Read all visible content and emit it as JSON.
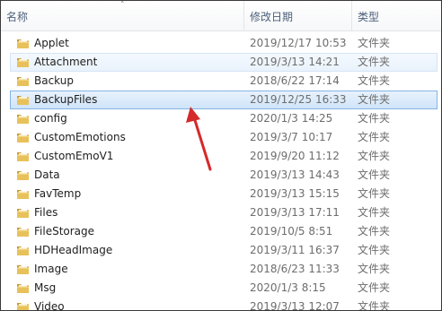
{
  "header": {
    "name_label": "名称",
    "date_label": "修改日期",
    "type_label": "类型",
    "sort_indicator": "˄"
  },
  "files": [
    {
      "name": "Applet",
      "date": "2019/12/17 10:53",
      "type": "文件夹",
      "state": "normal"
    },
    {
      "name": "Attachment",
      "date": "2019/3/13 14:21",
      "type": "文件夹",
      "state": "hover"
    },
    {
      "name": "Backup",
      "date": "2018/6/22 17:14",
      "type": "文件夹",
      "state": "normal"
    },
    {
      "name": "BackupFiles",
      "date": "2019/12/25 16:33",
      "type": "文件夹",
      "state": "selected"
    },
    {
      "name": "config",
      "date": "2020/1/3 14:25",
      "type": "文件夹",
      "state": "normal"
    },
    {
      "name": "CustomEmotions",
      "date": "2019/3/7 10:17",
      "type": "文件夹",
      "state": "normal"
    },
    {
      "name": "CustomEmoV1",
      "date": "2019/9/20 11:12",
      "type": "文件夹",
      "state": "normal"
    },
    {
      "name": "Data",
      "date": "2019/3/13 14:43",
      "type": "文件夹",
      "state": "normal"
    },
    {
      "name": "FavTemp",
      "date": "2019/3/13 15:15",
      "type": "文件夹",
      "state": "normal"
    },
    {
      "name": "Files",
      "date": "2019/3/13 17:11",
      "type": "文件夹",
      "state": "normal"
    },
    {
      "name": "FileStorage",
      "date": "2019/10/5 8:51",
      "type": "文件夹",
      "state": "normal"
    },
    {
      "name": "HDHeadImage",
      "date": "2019/3/11 16:37",
      "type": "文件夹",
      "state": "normal"
    },
    {
      "name": "Image",
      "date": "2018/6/23 11:33",
      "type": "文件夹",
      "state": "normal"
    },
    {
      "name": "Msg",
      "date": "2020/1/3 8:15",
      "type": "文件夹",
      "state": "normal"
    },
    {
      "name": "Video",
      "date": "2019/3/13 12:07",
      "type": "文件夹",
      "state": "normal"
    }
  ],
  "colors": {
    "folder_body": "#e8c15a",
    "folder_dark": "#c99a2e",
    "annotation_arrow": "#d42a2a",
    "selection_border": "#86b4e4"
  },
  "icons": {
    "folder": "folder-icon",
    "annotation": "red-arrow-annotation"
  }
}
